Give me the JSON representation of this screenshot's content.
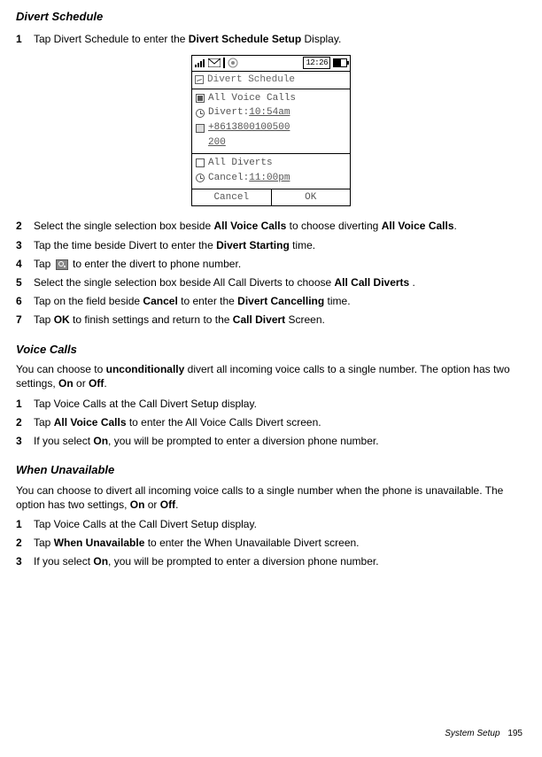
{
  "sections": {
    "divert_schedule": {
      "title": "Divert Schedule",
      "step1_pre": "Tap Divert Schedule to enter the ",
      "step1_b1": "Divert Schedule",
      "step1_b2": " Setup",
      "step1_post": " Display.",
      "step2_pre": "Select the single selection box beside ",
      "step2_b1": "All Voice Calls",
      "step2_mid": " to choose diverting ",
      "step2_b2": "All Voice Calls",
      "step2_post": ".",
      "step3_pre": "Tap the time beside Divert to enter the ",
      "step3_b": "Divert Starting",
      "step3_post": " time.",
      "step4_pre": "Tap ",
      "step4_post": " to enter the divert to phone number.",
      "step5_pre": "Select the single selection box beside All Call Diverts to choose ",
      "step5_b": "All Call Diverts",
      "step5_post": " .",
      "step6_pre": "Tap on the field beside ",
      "step6_b1": "Cancel",
      "step6_mid": " to enter the ",
      "step6_b2": "Divert Cancelling",
      "step6_post": " time.",
      "step7_pre": "Tap ",
      "step7_b1": "OK",
      "step7_mid": " to finish settings and return to the ",
      "step7_b2": "Call Divert",
      "step7_post": " Screen."
    },
    "voice_calls": {
      "title": "Voice Calls",
      "intro_pre": "You can choose to ",
      "intro_b1": "unconditionally",
      "intro_mid": " divert all incoming voice calls to a single number. The option has two settings, ",
      "intro_b2": "On",
      "intro_or": " or ",
      "intro_b3": "Off",
      "intro_post": ".",
      "step1": "Tap Voice Calls at the Call Divert   Setup display.",
      "step2_pre": "Tap ",
      "step2_b": "All Voice Calls",
      "step2_post": " to enter the All Voice Calls Divert screen.",
      "step3_pre": "If you select ",
      "step3_b": "On",
      "step3_post": ", you will be prompted to enter a diversion phone number."
    },
    "when_unavailable": {
      "title": "When Unavailable",
      "intro_pre": "You can choose to divert all incoming voice calls to a single number when the phone is unavailable. The option has two settings, ",
      "intro_b1": "On",
      "intro_or": " or ",
      "intro_b2": "Off",
      "intro_post": ".",
      "step1": "Tap Voice Calls at the Call Divert   Setup display.",
      "step2_pre": "Tap ",
      "step2_b": "When Unavailable",
      "step2_post": " to enter the When Unavailable Divert screen.",
      "step3_pre": "If you select ",
      "step3_b": "On",
      "step3_post": ", you will be prompted to enter a diversion phone number."
    }
  },
  "nums": {
    "n1": "1",
    "n2": "2",
    "n3": "3",
    "n4": "4",
    "n5": "5",
    "n6": "6",
    "n7": "7"
  },
  "phone": {
    "time": "12:26",
    "title": "Divert Schedule",
    "row_all_voice": "All Voice Calls",
    "row_divert_label": "Divert:",
    "row_divert_time": "10:54am",
    "row_phone": "+8613800100500",
    "row_phone_cont": "200",
    "row_all_diverts": "All Diverts",
    "row_cancel_label": "Cancel:",
    "row_cancel_time": "11:00pm",
    "btn_cancel": "Cancel",
    "btn_ok": "OK"
  },
  "footer": {
    "label": "System Setup",
    "page": "195"
  }
}
